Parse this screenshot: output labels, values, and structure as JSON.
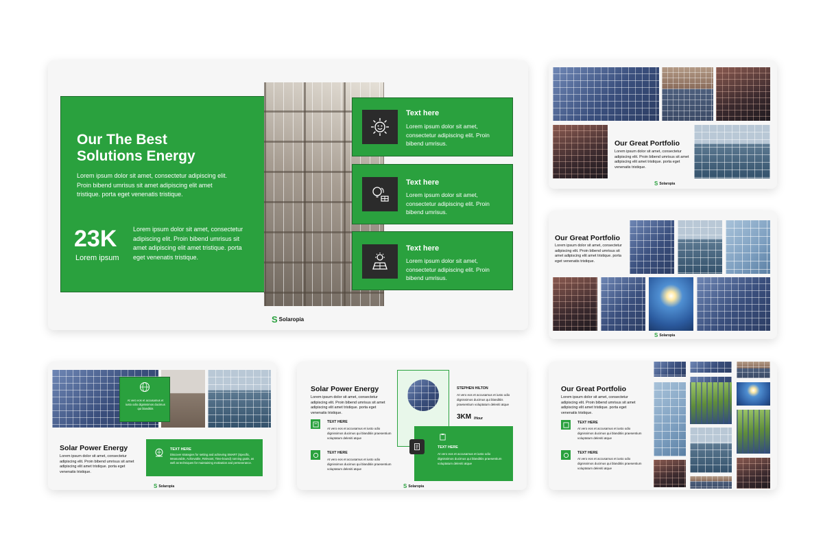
{
  "slide1": {
    "title_line1": "Our The Best",
    "title_line2": "Solutions Energy",
    "body": "Lorem ipsum dolor sit amet, consectetur adipiscing elit. Proin bibend umrisus sit amet adipiscing elit amet tristique. porta eget venenatis tristique.",
    "stat_value": "23K",
    "stat_label": "Lorem ipsum",
    "stat_body": "Lorem ipsum dolor sit amet, consectetur adipiscing elit. Proin bibend umrisus sit amet adipiscing elit amet tristique. porta eget venenatis tristique.",
    "cards": [
      {
        "title": "Text here",
        "body": "Lorem ipsum dolor sit amet, consectetur adipiscing elit. Proin bibend umrisus.",
        "icon": "sun-gear-icon"
      },
      {
        "title": "Text here",
        "body": "Lorem ipsum dolor sit amet, consectetur adipiscing elit. Proin bibend umrisus.",
        "icon": "bulb-solar-icon"
      },
      {
        "title": "Text here",
        "body": "Lorem ipsum dolor sit amet, consectetur adipiscing elit. Proin bibend umrisus.",
        "icon": "sun-panel-icon"
      }
    ],
    "logo": "Solaropia"
  },
  "slide2": {
    "title": "Our Great Portfolio",
    "body": "Lorem ipsum dolor sit amet, consectetur adipiscing elit. Proin bibend umrisus sit amet adipiscing elit amet tristique. porta eget venenatis tristique.",
    "logo": "Solaropia"
  },
  "slide3": {
    "title": "Our Great Portfolio",
    "body": "Lorem ipsum dolor sit amet, consectetur adipiscing elit. Proin bibend umrisus sit amet adipiscing elit amet tristique. porta eget venenatis tristique.",
    "logo": "Solaropia"
  },
  "slide4": {
    "box_text": "At vero eos et accusamus et iusto odio dignissimos ducimus qui blanditiis",
    "title": "Solar Power Energy",
    "body": "Lorem ipsum dolor sit amet, consectetur adipiscing elit. Proin bibend umrisus sit amet adipiscing elit amet tristique. porta eget venenatis tristique.",
    "card_title": "TEXT HERE",
    "card_body": "Discover strategies for setting and achieving SMART (Specific, Measurable, Achievable, Relevant, Time-bound) running goals, as well as techniques for maintaining motivation and perseverance.",
    "logo": "Solaropia"
  },
  "slide5": {
    "title": "Solar Power Energy",
    "body": "Lorem ipsum dolor sit amet, consectetur adipiscing elit. Proin bibend umrisus sit amet adipiscing elit amet tristique. porta eget venenatis tristique.",
    "items": [
      {
        "title": "TEXT HERE",
        "body": "At vero eos et accusamus et iusto odio dignissimos ducimus qui blanditiis praesentium voluptatum deleniti atque"
      },
      {
        "title": "TEXT HERE",
        "body": "At vero eos et accusamus et iusto odio dignissimos ducimus qui blanditiis praesentium voluptatum deleniti atque"
      }
    ],
    "person_name": "STEPHEN HILTON",
    "person_body": "At vero eos et accusamus et iusto odio dignissimos ducimus qui blanditiis praesentium voluptatum deleniti atque",
    "metric_value": "3KM",
    "metric_unit": "/Hour",
    "green_title": "TEXT HERE",
    "green_body": "At vero eos et accusamus et iusto odio dignissimos ducimus qui blanditiis praesentium voluptatum deleniti atque",
    "logo": "Solaropia"
  },
  "slide6": {
    "title": "Our Great Portfolio",
    "body": "Lorem ipsum dolor sit amet, consectetur adipiscing elit. Proin bibend umrisus sit amet adipiscing elit amet tristique. porta eget venenatis tristique.",
    "items": [
      {
        "title": "TEXT HERE",
        "body": "At vero eos et accusamus et iusto odio dignissimos ducimus qui blanditiis praesentium voluptatum deleniti atque"
      },
      {
        "title": "TEXT HERE",
        "body": "At vero eos et accusamus et iusto odio dignissimos ducimus qui blanditiis praesentium voluptatum deleniti atque"
      }
    ]
  },
  "colors": {
    "accent": "#2aa13e",
    "dark_icon_bg": "#2b2b2b",
    "slide_bg": "#f6f6f6"
  }
}
